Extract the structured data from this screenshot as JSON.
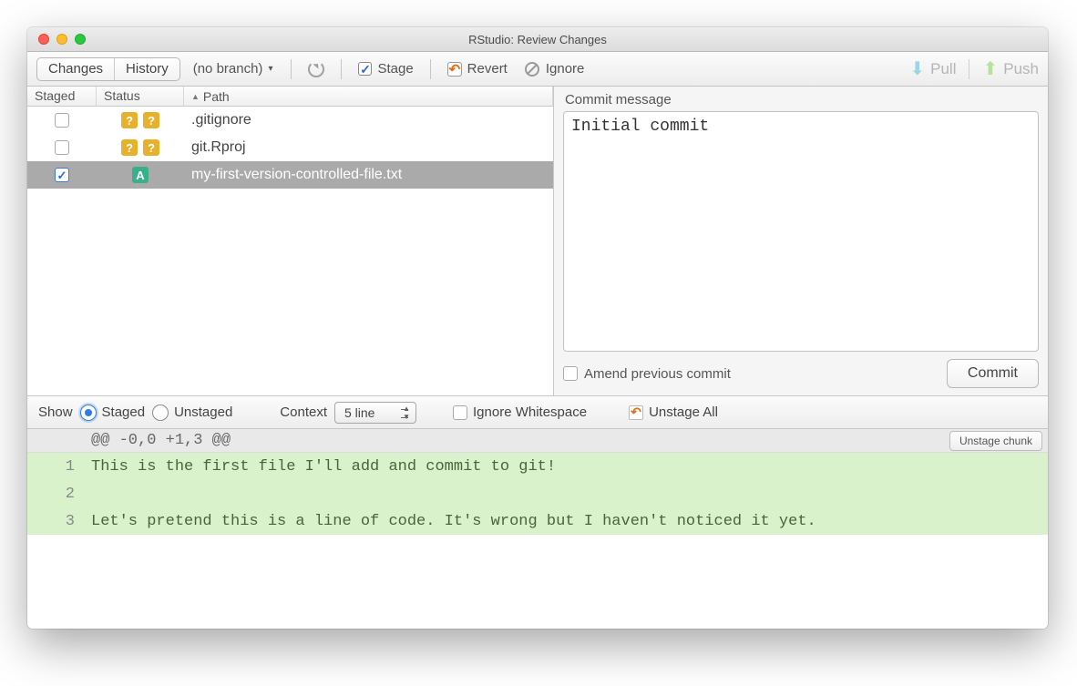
{
  "window": {
    "title": "RStudio: Review Changes"
  },
  "toolbar": {
    "changes": "Changes",
    "history": "History",
    "branch": "(no branch)",
    "stage": "Stage",
    "revert": "Revert",
    "ignore": "Ignore",
    "pull": "Pull",
    "push": "Push"
  },
  "filelist": {
    "headers": {
      "staged": "Staged",
      "status": "Status",
      "path": "Path"
    },
    "rows": [
      {
        "staged": false,
        "status": [
          "?",
          "?"
        ],
        "status_kind": "q",
        "path": ".gitignore",
        "selected": false
      },
      {
        "staged": false,
        "status": [
          "?",
          "?"
        ],
        "status_kind": "q",
        "path": "git.Rproj",
        "selected": false
      },
      {
        "staged": true,
        "status": [
          "A"
        ],
        "status_kind": "a",
        "path": "my-first-version-controlled-file.txt",
        "selected": true
      }
    ]
  },
  "commit": {
    "label": "Commit message",
    "message": "Initial commit",
    "amend_label": "Amend previous commit",
    "commit_button": "Commit"
  },
  "difftoolbar": {
    "show": "Show",
    "staged": "Staged",
    "unstaged": "Unstaged",
    "context": "Context",
    "context_value": "5 line",
    "ignore_ws": "Ignore Whitespace",
    "unstage_all": "Unstage All"
  },
  "diff": {
    "hunk": "@@ -0,0 +1,3 @@",
    "unstage_chunk": "Unstage chunk",
    "lines": [
      {
        "n": "1",
        "text": "This is the first file I'll add and commit to git!"
      },
      {
        "n": "2",
        "text": ""
      },
      {
        "n": "3",
        "text": "Let's pretend this is a line of code. It's wrong but I haven't noticed it yet."
      }
    ]
  }
}
